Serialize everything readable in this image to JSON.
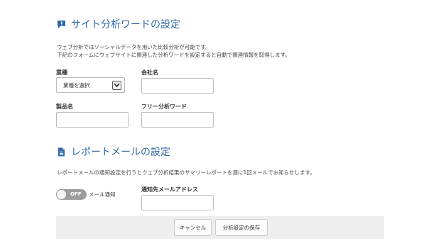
{
  "colors": {
    "accent": "#2f6aa8",
    "toggle_off": "#9d9d9d",
    "footer_bg": "#eeeeee"
  },
  "site_analysis": {
    "icon": "comment-exclamation-icon",
    "title": "サイト分析ワードの設定",
    "desc_line1": "ウェブ分析ではソーシャルデータを用いた比較分析が可能です。",
    "desc_line2": "下記のフォームにウェブサイトに関連した分析ワードを設定すると自動で関連情報を取得します。",
    "industry": {
      "label": "業種",
      "selected": "業種を選択"
    },
    "company": {
      "label": "会社名",
      "value": ""
    },
    "product": {
      "label": "製品名",
      "value": ""
    },
    "free_word": {
      "label": "フリー分析ワード",
      "value": ""
    }
  },
  "report_mail": {
    "icon": "document-icon",
    "title": "レポートメールの設定",
    "desc": "レポートメールの通知設定を行うとウェブ分析結果のサマリーレポートを週に1回メールでお知らせします。",
    "toggle": {
      "state_text": "OFF",
      "label": "メール通知",
      "on": false
    },
    "address": {
      "label": "通知先メールアドレス",
      "value": ""
    }
  },
  "footer": {
    "cancel_label": "キャンセル",
    "save_label": "分析設定の保存"
  }
}
